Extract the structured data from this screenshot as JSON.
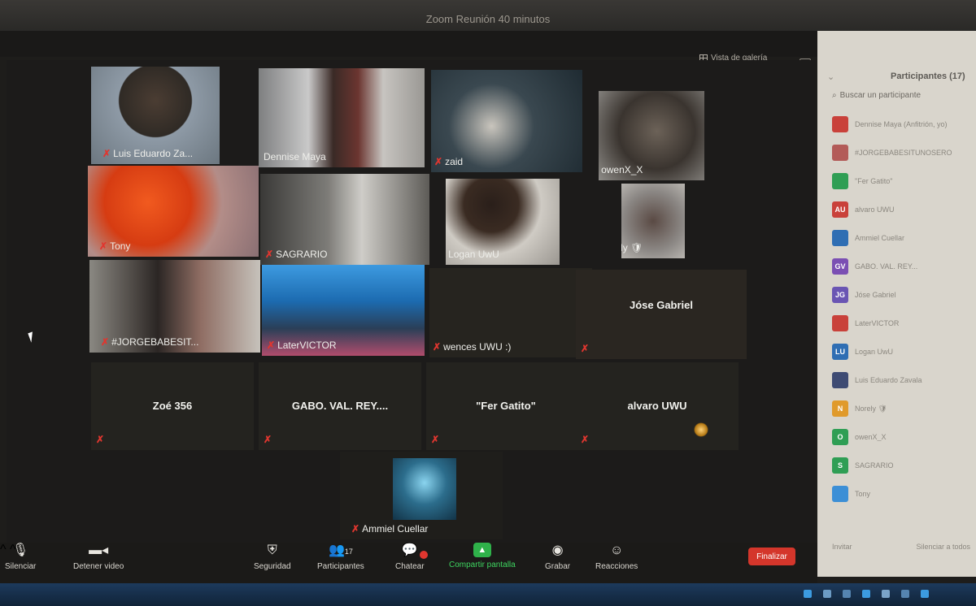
{
  "window": {
    "title": "Zoom Reunión 40 minutos"
  },
  "header": {
    "gallery_view_label": "Vista de galería"
  },
  "participants_grid": [
    {
      "name": "Luis Eduardo Za..."
    },
    {
      "name": "Dennise Maya"
    },
    {
      "name": "zaid"
    },
    {
      "name": "owenX_X"
    },
    {
      "name": "Tony"
    },
    {
      "name": "SAGRARIO"
    },
    {
      "name": "Logan UwU"
    },
    {
      "name": "Norely 🛡"
    },
    {
      "name": "#JORGEBABESIT..."
    },
    {
      "name": "LaterVICTOR"
    },
    {
      "name": "wences UWU :)"
    },
    {
      "name": "Jóse Gabriel"
    },
    {
      "name": "Zoé 356"
    },
    {
      "name": "GABO. VAL. REY...."
    },
    {
      "name": "\"Fer Gatito\""
    },
    {
      "name": "alvaro UWU"
    },
    {
      "name": "Ammiel Cuellar"
    }
  ],
  "sidebar": {
    "title": "Participantes (17)",
    "search_placeholder": "Buscar un participante",
    "items": [
      {
        "initials": "",
        "name": "Dennise Maya (Anfitrión, yo)",
        "color": "#c9413a"
      },
      {
        "initials": "",
        "name": "#JORGEBABESITUNOSERO",
        "color": "#b35b58"
      },
      {
        "initials": "",
        "name": "\"Fer Gatito\"",
        "color": "#2f9e54"
      },
      {
        "initials": "AU",
        "name": "alvaro UWU",
        "color": "#c9413a"
      },
      {
        "initials": "",
        "name": "Ammiel Cuellar",
        "color": "#2f6eb3"
      },
      {
        "initials": "GV",
        "name": "GABO. VAL. REY...",
        "color": "#7b4fb3"
      },
      {
        "initials": "JG",
        "name": "Jóse Gabriel",
        "color": "#6a55b3"
      },
      {
        "initials": "",
        "name": "LaterVICTOR",
        "color": "#c9413a"
      },
      {
        "initials": "LU",
        "name": "Logan UwU",
        "color": "#2f6eb3"
      },
      {
        "initials": "",
        "name": "Luis Eduardo Zavala",
        "color": "#3e4b73"
      },
      {
        "initials": "N",
        "name": "Norely 🛡",
        "color": "#e09a2b"
      },
      {
        "initials": "O",
        "name": "owenX_X",
        "color": "#2f9e54"
      },
      {
        "initials": "S",
        "name": "SAGRARIO",
        "color": "#2f9e54"
      },
      {
        "initials": "",
        "name": "Tony",
        "color": "#3c8fd6"
      }
    ],
    "footer_invite": "Invitar",
    "footer_mute_all": "Silenciar a todos"
  },
  "toolbar": {
    "mute_label": "Silenciar",
    "video_label": "Detener video",
    "security_label": "Seguridad",
    "participants_label": "Participantes",
    "participants_count": "17",
    "chat_label": "Chatear",
    "share_label": "Compartir pantalla",
    "record_label": "Grabar",
    "reactions_label": "Reacciones",
    "end_label": "Finalizar"
  }
}
